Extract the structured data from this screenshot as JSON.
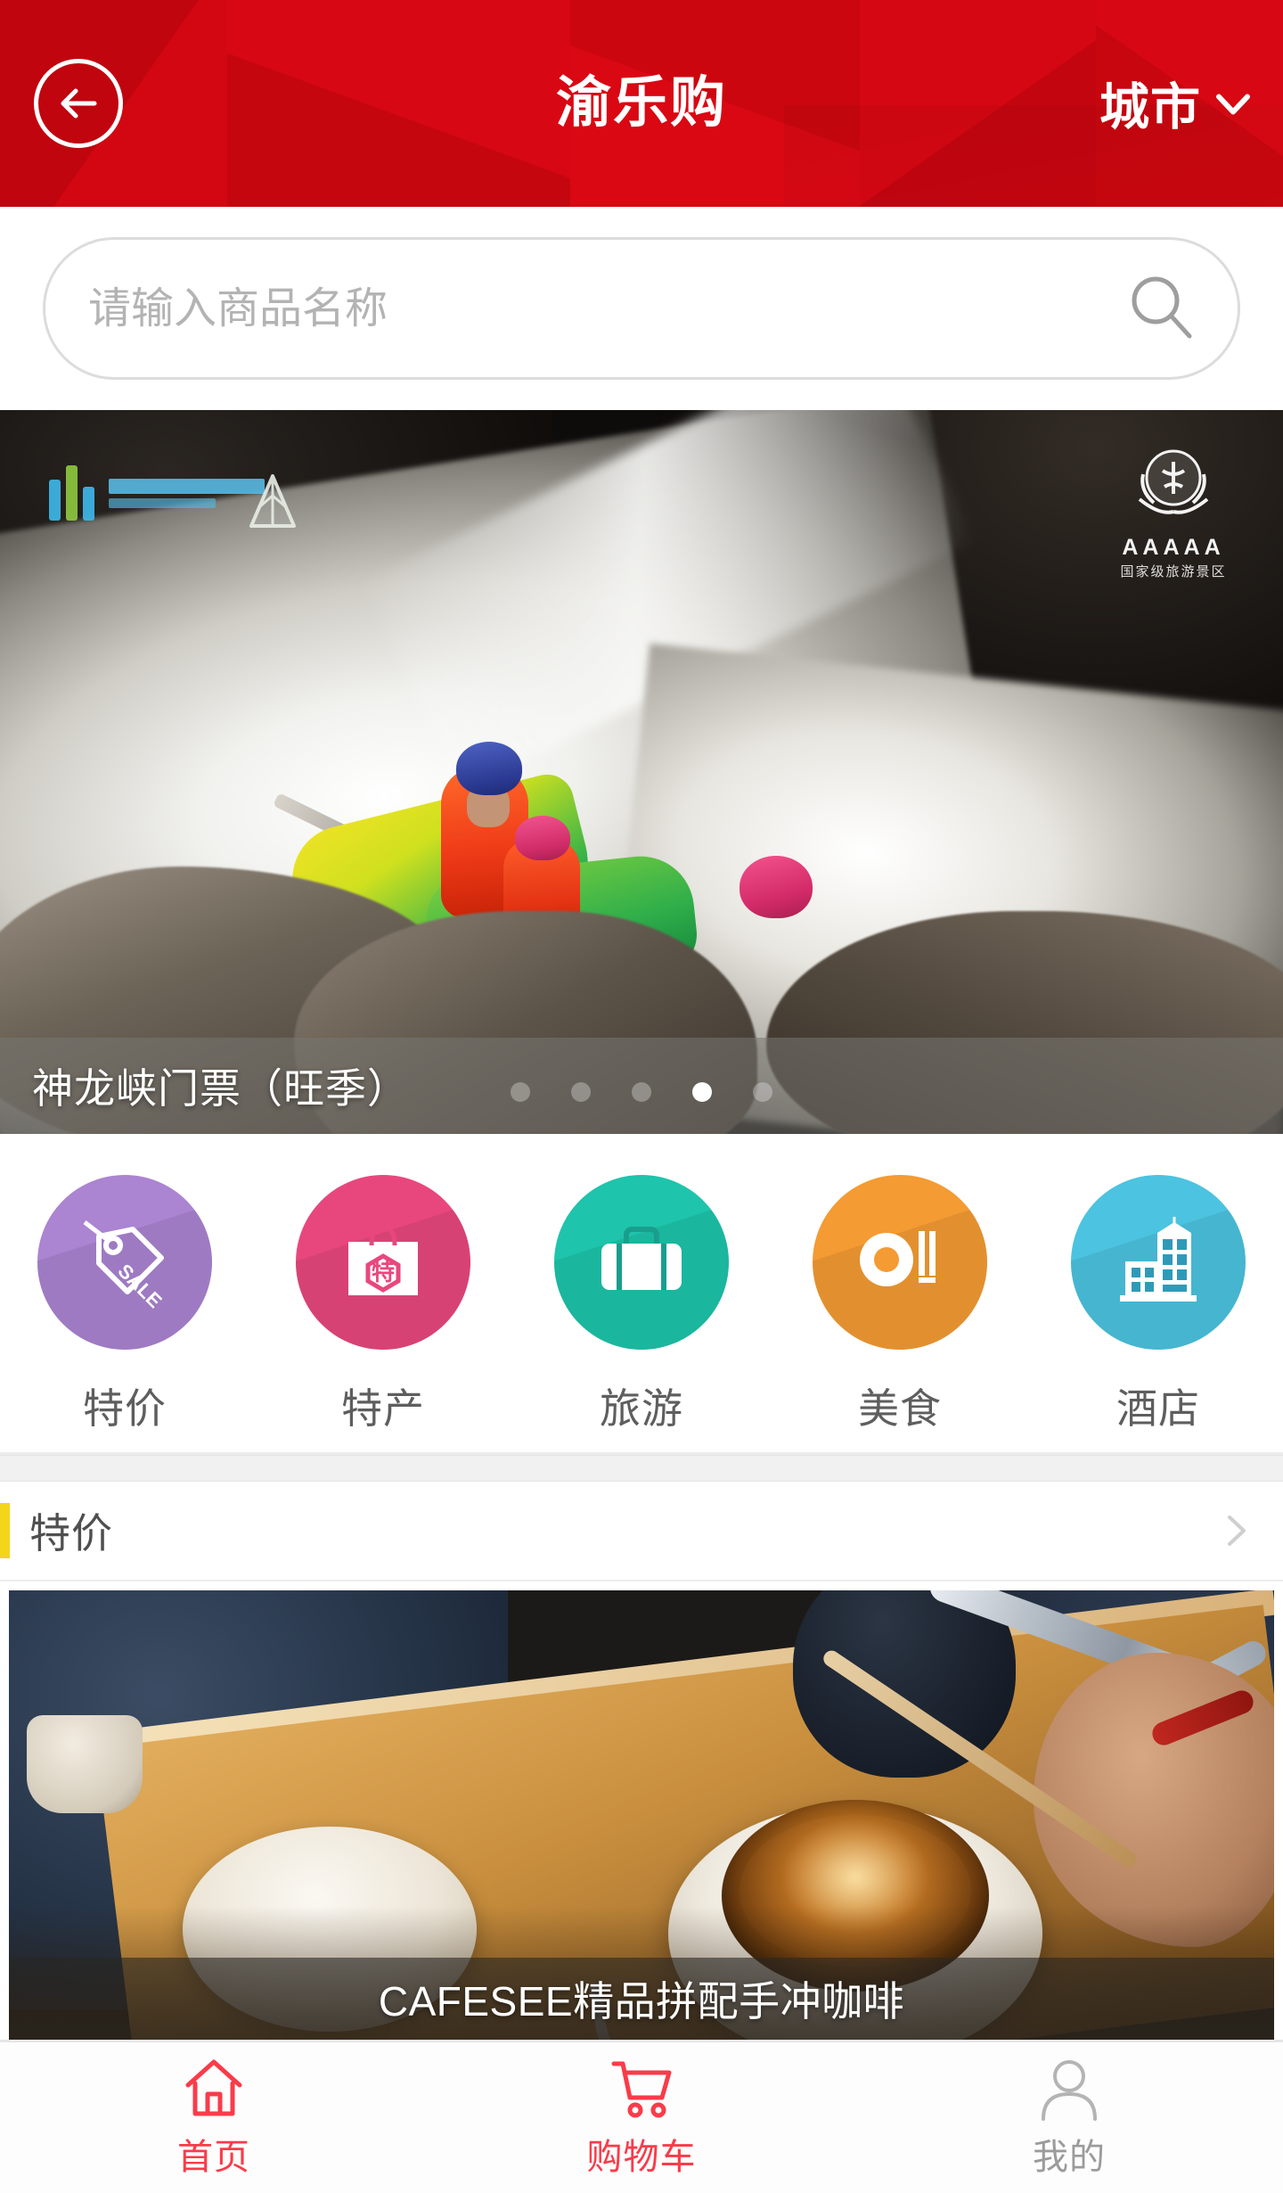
{
  "header": {
    "title": "渝乐购",
    "back_icon": "back-arrow-icon",
    "city_label": "城市",
    "city_chevron_icon": "chevron-down-icon",
    "background_color": "#cf0611"
  },
  "search": {
    "placeholder": "请输入商品名称",
    "value": "",
    "icon": "search-icon"
  },
  "banner": {
    "caption": "神龙峡门票（旺季）",
    "badge_stars": "AAAAA",
    "badge_text": "国家级旅游景区",
    "dots_total": 5,
    "active_dot": 4,
    "image_alt": "白水漂流"
  },
  "categories": [
    {
      "label": "特价",
      "icon": "sale-tag-icon",
      "color": "#ab84d2"
    },
    {
      "label": "特产",
      "icon": "gift-box-icon",
      "color": "#e8477e"
    },
    {
      "label": "旅游",
      "icon": "suitcase-icon",
      "color": "#1ec4ab"
    },
    {
      "label": "美食",
      "icon": "plate-cutlery-icon",
      "color": "#f49b33"
    },
    {
      "label": "酒店",
      "icon": "hotel-building-icon",
      "color": "#4cc3e0"
    }
  ],
  "section": {
    "title": "特价",
    "accent_color": "#f3d519",
    "more_icon": "chevron-right-icon"
  },
  "product": {
    "title": "CAFESEE精品拼配手冲咖啡",
    "image_alt": "手冲咖啡"
  },
  "tabbar": [
    {
      "label": "首页",
      "icon": "home-icon",
      "active": true
    },
    {
      "label": "购物车",
      "icon": "cart-icon",
      "active": true
    },
    {
      "label": "我的",
      "icon": "user-icon",
      "active": false
    }
  ]
}
